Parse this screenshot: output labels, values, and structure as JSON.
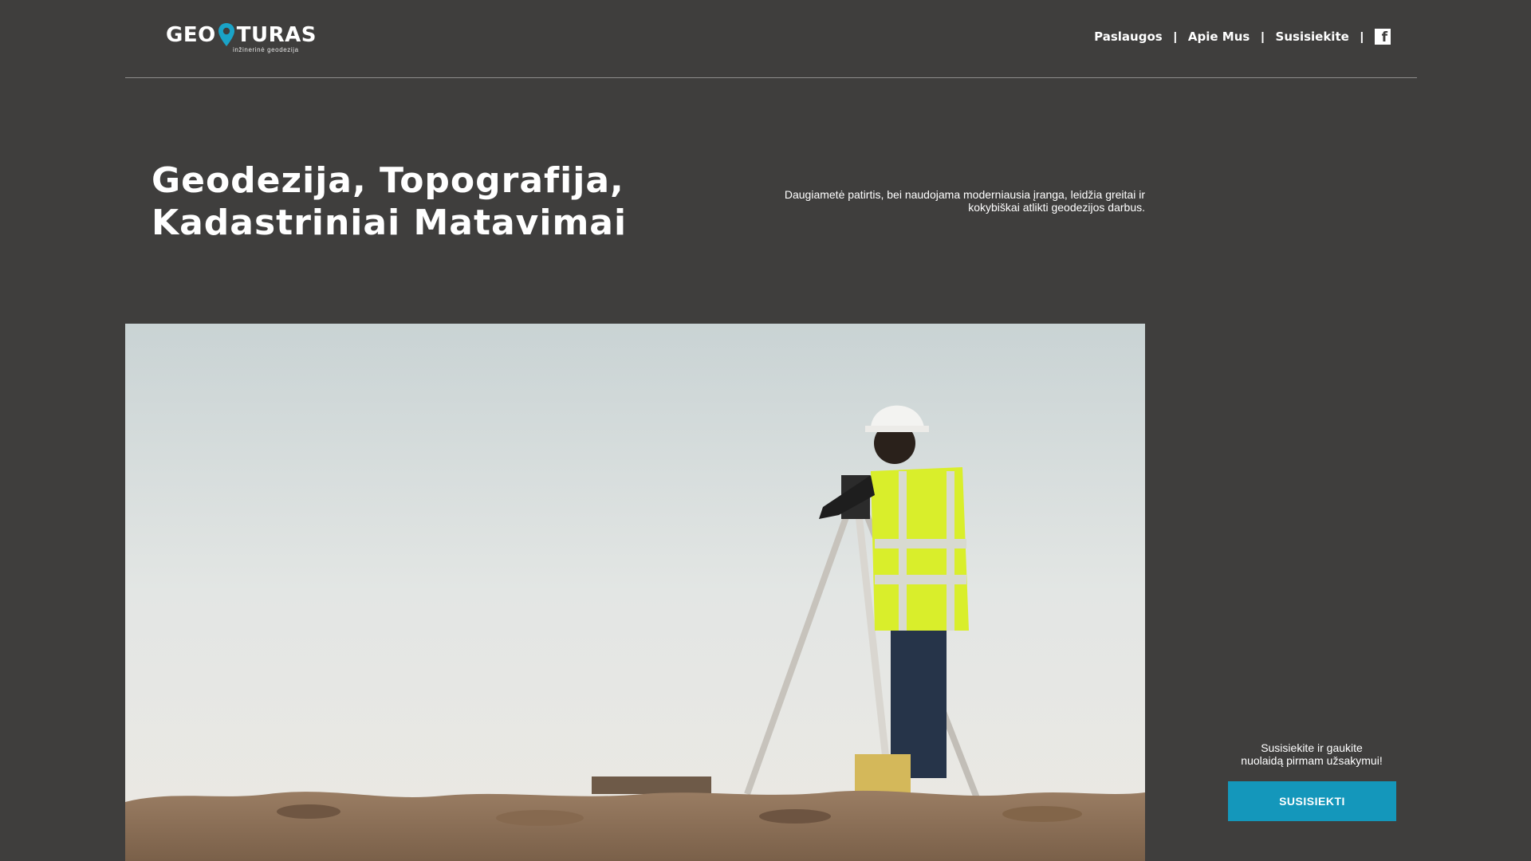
{
  "header": {
    "logo": {
      "text_left": "GEO",
      "text_right": "TURAS",
      "tagline": "inžinerinė geodezija",
      "pin_color": "#1aa3c7"
    },
    "nav": {
      "items": [
        {
          "label": "Paslaugos"
        },
        {
          "label": "Apie Mus"
        },
        {
          "label": "Susisiekite"
        }
      ],
      "separator": "|",
      "facebook_icon": "facebook-icon"
    }
  },
  "hero": {
    "title_line1": "Geodezija, Topografija,",
    "title_line2": "Kadastriniai Matavimai",
    "description": "Daugiametė patirtis, bei naudojama moderniausia įranga, leidžia greitai ir kokybiškai atlikti geodezijos darbus."
  },
  "cta": {
    "text_line1": "Susisiekite ir gaukite",
    "text_line2": "nuolaidą pirmam užsakymui!",
    "button_label": "SUSISIEKTI",
    "button_color": "#1497bb"
  },
  "colors": {
    "background": "#3f3e3d",
    "accent": "#1497bb"
  }
}
